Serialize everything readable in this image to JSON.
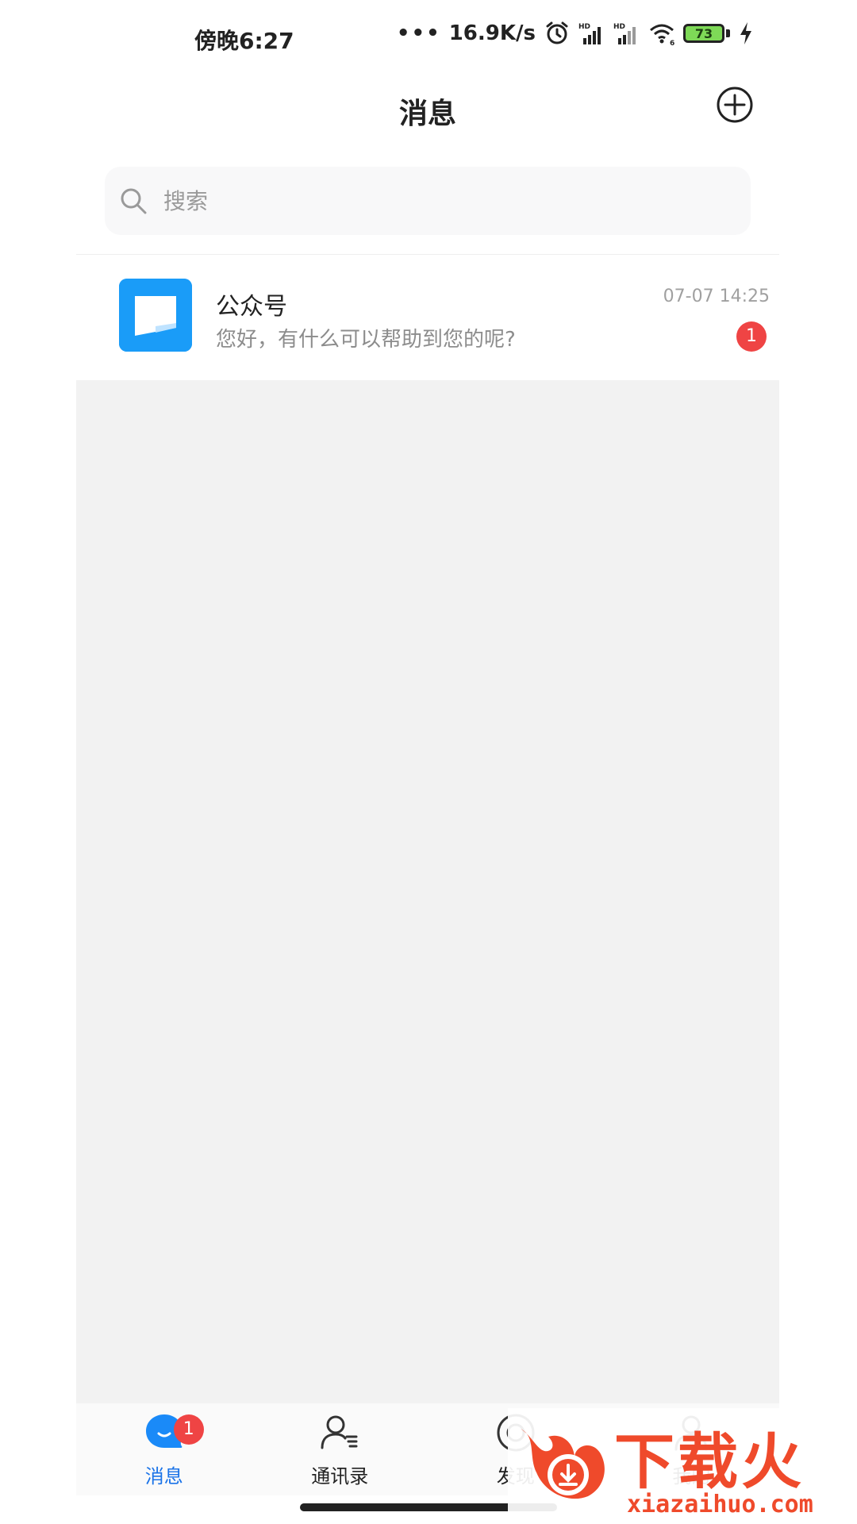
{
  "status_bar": {
    "time": "傍晚6:27",
    "dots": "•••",
    "speed": "16.9K/s",
    "battery_level": "73",
    "icons": [
      "alarm-icon",
      "signal-hd-icon",
      "signal-hd-icon",
      "wifi-icon",
      "battery-icon",
      "charging-icon"
    ]
  },
  "header": {
    "title": "消息",
    "add_icon": "plus-circle-icon"
  },
  "search": {
    "placeholder": "搜索",
    "icon": "search-icon"
  },
  "conversations": [
    {
      "title": "公众号",
      "preview": "您好，有什么可以帮助到您的呢?",
      "time": "07-07 14:25",
      "unread": "1",
      "avatar_color": "#1a9cf8"
    }
  ],
  "tabbar": {
    "tabs": [
      {
        "label": "消息",
        "icon": "chat-bubble-icon",
        "active": true,
        "badge": "1"
      },
      {
        "label": "通讯录",
        "icon": "contacts-icon",
        "active": false
      },
      {
        "label": "发现",
        "icon": "discover-icon",
        "active": false
      },
      {
        "label": "我的",
        "icon": "profile-icon",
        "active": false
      }
    ]
  },
  "watermark": {
    "brand_cn": "下载火",
    "brand_en": "xiazaihuo.com"
  },
  "colors": {
    "accent": "#1a73e8",
    "badge": "#ef4444",
    "content_bg": "#f2f2f2",
    "watermark": "#ef4a2b"
  }
}
